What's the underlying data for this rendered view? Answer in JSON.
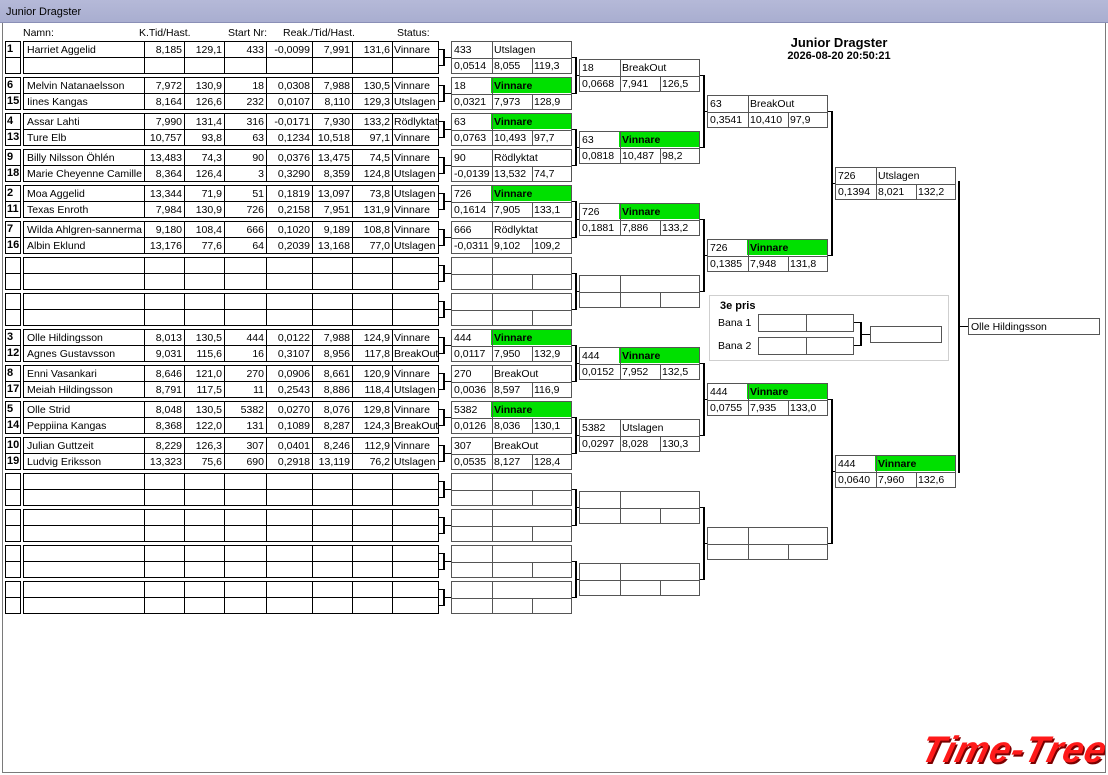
{
  "window": {
    "title": "Junior Dragster"
  },
  "header": {
    "title": "Junior Dragster",
    "datetime": "2026-08-20 20:50:21"
  },
  "columns": {
    "namn": "Namn:",
    "ktid": "K.Tid/Hast.",
    "start": "Start Nr:",
    "reak": "Reak./Tid/Hast.",
    "status": "Status:"
  },
  "entries": [
    {
      "seed": "1",
      "name": "Harriet Aggelid",
      "ktid": "8,185",
      "khast": "129,1",
      "start": "433",
      "reak": "-0,0099",
      "tid": "7,991",
      "hast": "131,6",
      "status": "Vinnare"
    },
    {
      "seed": "",
      "name": "",
      "ktid": "",
      "khast": "",
      "start": "",
      "reak": "",
      "tid": "",
      "hast": "",
      "status": ""
    },
    {
      "seed": "6",
      "name": "Melvin Natanaelsson",
      "ktid": "7,972",
      "khast": "130,9",
      "start": "18",
      "reak": "0,0308",
      "tid": "7,988",
      "hast": "130,5",
      "status": "Vinnare"
    },
    {
      "seed": "15",
      "name": "Iines Kangas",
      "ktid": "8,164",
      "khast": "126,6",
      "start": "232",
      "reak": "0,0107",
      "tid": "8,110",
      "hast": "129,3",
      "status": "Utslagen"
    },
    {
      "seed": "4",
      "name": "Assar Lahti",
      "ktid": "7,990",
      "khast": "131,4",
      "start": "316",
      "reak": "-0,0171",
      "tid": "7,930",
      "hast": "133,2",
      "status": "Rödlyktat"
    },
    {
      "seed": "13",
      "name": "Ture Elb",
      "ktid": "10,757",
      "khast": "93,8",
      "start": "63",
      "reak": "0,1234",
      "tid": "10,518",
      "hast": "97,1",
      "status": "Vinnare"
    },
    {
      "seed": "9",
      "name": "Billy Nilsson Öhlén",
      "ktid": "13,483",
      "khast": "74,3",
      "start": "90",
      "reak": "0,0376",
      "tid": "13,475",
      "hast": "74,5",
      "status": "Vinnare"
    },
    {
      "seed": "18",
      "name": "Marie Cheyenne Camille",
      "ktid": "8,364",
      "khast": "126,4",
      "start": "3",
      "reak": "0,3290",
      "tid": "8,359",
      "hast": "124,8",
      "status": "Utslagen"
    },
    {
      "seed": "2",
      "name": "Moa Aggelid",
      "ktid": "13,344",
      "khast": "71,9",
      "start": "51",
      "reak": "0,1819",
      "tid": "13,097",
      "hast": "73,8",
      "status": "Utslagen"
    },
    {
      "seed": "11",
      "name": "Texas Enroth",
      "ktid": "7,984",
      "khast": "130,9",
      "start": "726",
      "reak": "0,2158",
      "tid": "7,951",
      "hast": "131,9",
      "status": "Vinnare"
    },
    {
      "seed": "7",
      "name": "Wilda Ahlgren-sannerma",
      "ktid": "9,180",
      "khast": "108,4",
      "start": "666",
      "reak": "0,1020",
      "tid": "9,189",
      "hast": "108,8",
      "status": "Vinnare"
    },
    {
      "seed": "16",
      "name": "Albin Eklund",
      "ktid": "13,176",
      "khast": "77,6",
      "start": "64",
      "reak": "0,2039",
      "tid": "13,168",
      "hast": "77,0",
      "status": "Utslagen"
    },
    {
      "seed": "",
      "name": "",
      "ktid": "",
      "khast": "",
      "start": "",
      "reak": "",
      "tid": "",
      "hast": "",
      "status": ""
    },
    {
      "seed": "",
      "name": "",
      "ktid": "",
      "khast": "",
      "start": "",
      "reak": "",
      "tid": "",
      "hast": "",
      "status": ""
    },
    {
      "seed": "",
      "name": "",
      "ktid": "",
      "khast": "",
      "start": "",
      "reak": "",
      "tid": "",
      "hast": "",
      "status": ""
    },
    {
      "seed": "",
      "name": "",
      "ktid": "",
      "khast": "",
      "start": "",
      "reak": "",
      "tid": "",
      "hast": "",
      "status": ""
    },
    {
      "seed": "3",
      "name": "Olle Hildingsson",
      "ktid": "8,013",
      "khast": "130,5",
      "start": "444",
      "reak": "0,0122",
      "tid": "7,988",
      "hast": "124,9",
      "status": "Vinnare"
    },
    {
      "seed": "12",
      "name": "Agnes Gustavsson",
      "ktid": "9,031",
      "khast": "115,6",
      "start": "16",
      "reak": "0,3107",
      "tid": "8,956",
      "hast": "117,8",
      "status": "BreakOut"
    },
    {
      "seed": "8",
      "name": "Enni Vasankari",
      "ktid": "8,646",
      "khast": "121,0",
      "start": "270",
      "reak": "0,0906",
      "tid": "8,661",
      "hast": "120,9",
      "status": "Vinnare"
    },
    {
      "seed": "17",
      "name": "Meiah Hildingsson",
      "ktid": "8,791",
      "khast": "117,5",
      "start": "11",
      "reak": "0,2543",
      "tid": "8,886",
      "hast": "118,4",
      "status": "Utslagen"
    },
    {
      "seed": "5",
      "name": "Olle Strid",
      "ktid": "8,048",
      "khast": "130,5",
      "start": "5382",
      "reak": "0,0270",
      "tid": "8,076",
      "hast": "129,8",
      "status": "Vinnare"
    },
    {
      "seed": "14",
      "name": "Peppiina Kangas",
      "ktid": "8,368",
      "khast": "122,0",
      "start": "131",
      "reak": "0,1089",
      "tid": "8,287",
      "hast": "124,3",
      "status": "BreakOut"
    },
    {
      "seed": "10",
      "name": "Julian  Guttzeit",
      "ktid": "8,229",
      "khast": "126,3",
      "start": "307",
      "reak": "0,0401",
      "tid": "8,246",
      "hast": "112,9",
      "status": "Vinnare"
    },
    {
      "seed": "19",
      "name": "Ludvig  Eriksson",
      "ktid": "13,323",
      "khast": "75,6",
      "start": "690",
      "reak": "0,2918",
      "tid": "13,119",
      "hast": "76,2",
      "status": "Utslagen"
    },
    {
      "seed": "",
      "name": "",
      "ktid": "",
      "khast": "",
      "start": "",
      "reak": "",
      "tid": "",
      "hast": "",
      "status": ""
    },
    {
      "seed": "",
      "name": "",
      "ktid": "",
      "khast": "",
      "start": "",
      "reak": "",
      "tid": "",
      "hast": "",
      "status": ""
    },
    {
      "seed": "",
      "name": "",
      "ktid": "",
      "khast": "",
      "start": "",
      "reak": "",
      "tid": "",
      "hast": "",
      "status": ""
    },
    {
      "seed": "",
      "name": "",
      "ktid": "",
      "khast": "",
      "start": "",
      "reak": "",
      "tid": "",
      "hast": "",
      "status": ""
    },
    {
      "seed": "",
      "name": "",
      "ktid": "",
      "khast": "",
      "start": "",
      "reak": "",
      "tid": "",
      "hast": "",
      "status": ""
    },
    {
      "seed": "",
      "name": "",
      "ktid": "",
      "khast": "",
      "start": "",
      "reak": "",
      "tid": "",
      "hast": "",
      "status": ""
    },
    {
      "seed": "",
      "name": "",
      "ktid": "",
      "khast": "",
      "start": "",
      "reak": "",
      "tid": "",
      "hast": "",
      "status": ""
    },
    {
      "seed": "",
      "name": "",
      "ktid": "",
      "khast": "",
      "start": "",
      "reak": "",
      "tid": "",
      "hast": "",
      "status": ""
    }
  ],
  "round1": [
    {
      "start": "433",
      "status": "Utslagen",
      "reak": "0,0514",
      "tid": "8,055",
      "hast": "119,3",
      "win": false
    },
    {
      "start": "18",
      "status": "Vinnare",
      "reak": "0,0321",
      "tid": "7,973",
      "hast": "128,9",
      "win": true
    },
    {
      "start": "63",
      "status": "Vinnare",
      "reak": "0,0763",
      "tid": "10,493",
      "hast": "97,7",
      "win": true
    },
    {
      "start": "90",
      "status": "Rödlyktat",
      "reak": "-0,0139",
      "tid": "13,532",
      "hast": "74,7",
      "win": false
    },
    {
      "start": "726",
      "status": "Vinnare",
      "reak": "0,1614",
      "tid": "7,905",
      "hast": "133,1",
      "win": true
    },
    {
      "start": "666",
      "status": "Rödlyktat",
      "reak": "-0,0311",
      "tid": "9,102",
      "hast": "109,2",
      "win": false
    },
    {
      "start": "",
      "status": "",
      "reak": "",
      "tid": "",
      "hast": "",
      "win": false
    },
    {
      "start": "",
      "status": "",
      "reak": "",
      "tid": "",
      "hast": "",
      "win": false
    },
    {
      "start": "444",
      "status": "Vinnare",
      "reak": "0,0117",
      "tid": "7,950",
      "hast": "132,9",
      "win": true
    },
    {
      "start": "270",
      "status": "BreakOut",
      "reak": "0,0036",
      "tid": "8,597",
      "hast": "116,9",
      "win": false
    },
    {
      "start": "5382",
      "status": "Vinnare",
      "reak": "0,0126",
      "tid": "8,036",
      "hast": "130,1",
      "win": true
    },
    {
      "start": "307",
      "status": "BreakOut",
      "reak": "0,0535",
      "tid": "8,127",
      "hast": "128,4",
      "win": false
    },
    {
      "start": "",
      "status": "",
      "reak": "",
      "tid": "",
      "hast": "",
      "win": false
    },
    {
      "start": "",
      "status": "",
      "reak": "",
      "tid": "",
      "hast": "",
      "win": false
    },
    {
      "start": "",
      "status": "",
      "reak": "",
      "tid": "",
      "hast": "",
      "win": false
    },
    {
      "start": "",
      "status": "",
      "reak": "",
      "tid": "",
      "hast": "",
      "win": false
    }
  ],
  "round2": [
    {
      "start": "18",
      "status": "BreakOut",
      "reak": "0,0668",
      "tid": "7,941",
      "hast": "126,5",
      "win": false
    },
    {
      "start": "63",
      "status": "Vinnare",
      "reak": "0,0818",
      "tid": "10,487",
      "hast": "98,2",
      "win": true
    },
    {
      "start": "726",
      "status": "Vinnare",
      "reak": "0,1881",
      "tid": "7,886",
      "hast": "133,2",
      "win": true
    },
    {
      "start": "",
      "status": "",
      "reak": "",
      "tid": "",
      "hast": "",
      "win": false
    },
    {
      "start": "444",
      "status": "Vinnare",
      "reak": "0,0152",
      "tid": "7,952",
      "hast": "132,5",
      "win": true
    },
    {
      "start": "5382",
      "status": "Utslagen",
      "reak": "0,0297",
      "tid": "8,028",
      "hast": "130,3",
      "win": false
    },
    {
      "start": "",
      "status": "",
      "reak": "",
      "tid": "",
      "hast": "",
      "win": false
    },
    {
      "start": "",
      "status": "",
      "reak": "",
      "tid": "",
      "hast": "",
      "win": false
    }
  ],
  "round3": [
    {
      "start": "63",
      "status": "BreakOut",
      "reak": "0,3541",
      "tid": "10,410",
      "hast": "97,9",
      "win": false
    },
    {
      "start": "726",
      "status": "Vinnare",
      "reak": "0,1385",
      "tid": "7,948",
      "hast": "131,8",
      "win": true
    },
    {
      "start": "444",
      "status": "Vinnare",
      "reak": "0,0755",
      "tid": "7,935",
      "hast": "133,0",
      "win": true
    },
    {
      "start": "",
      "status": "",
      "reak": "",
      "tid": "",
      "hast": "",
      "win": false
    }
  ],
  "round4": [
    {
      "start": "726",
      "status": "Utslagen",
      "reak": "0,1394",
      "tid": "8,021",
      "hast": "132,2",
      "win": false
    },
    {
      "start": "444",
      "status": "Vinnare",
      "reak": "0,0640",
      "tid": "7,960",
      "hast": "132,6",
      "win": true
    }
  ],
  "winner": "Olle Hildingsson",
  "third_place": {
    "title": "3e pris",
    "lane1": "Bana 1",
    "lane2": "Bana 2"
  },
  "logo": {
    "text": "Time-Tree"
  },
  "colors": {
    "winner_bg": "#00e000",
    "titlebar": "#afb3d4",
    "logo": "#ff1a1a"
  }
}
